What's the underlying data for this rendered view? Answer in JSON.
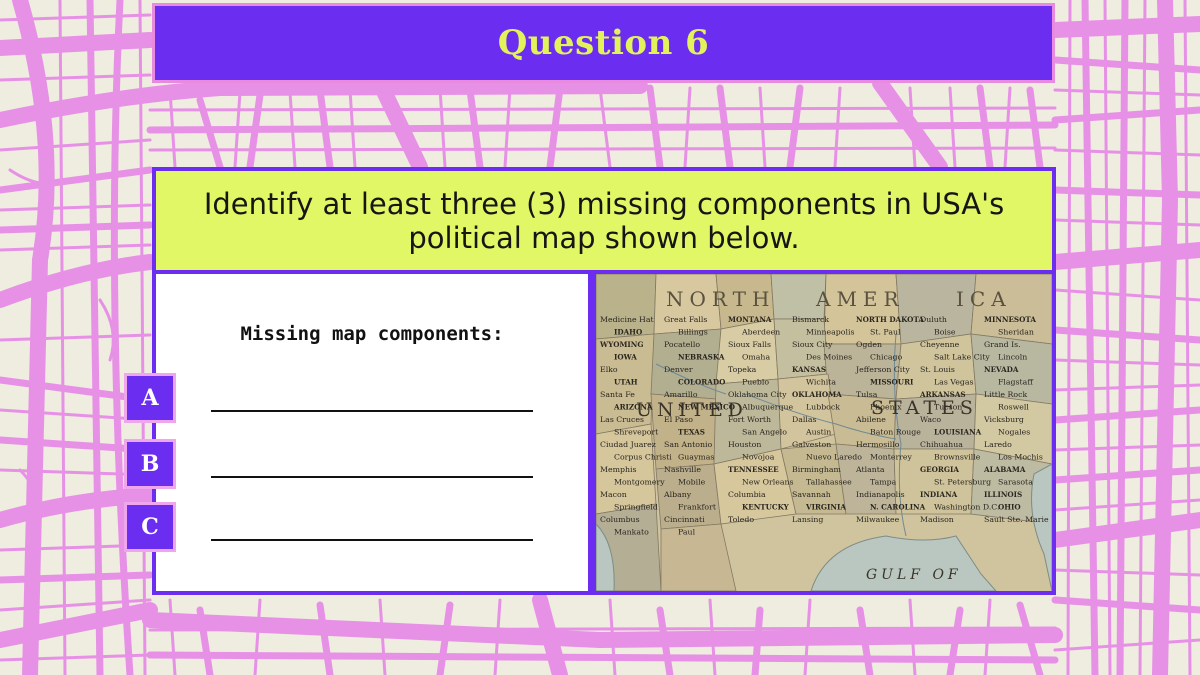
{
  "slide": {
    "title": "Question 6",
    "question": "Identify at least three (3) missing components in USA's political map shown below.",
    "answer_heading": "Missing map components:",
    "answer_letters": [
      "A",
      "B",
      "C"
    ]
  },
  "map_labels": {
    "top_row": [
      "NORTH",
      "AMER",
      "ICA"
    ],
    "states_word": [
      "UNITED",
      "STATES"
    ],
    "gulf": "GULF OF",
    "places": [
      "Medicine Hat",
      "Great Falls",
      "MONTANA",
      "Bismarck",
      "NORTH DAKOTA",
      "Duluth",
      "MINNESOTA",
      "IDAHO",
      "Billings",
      "Aberdeen",
      "Minneapolis",
      "St. Paul",
      "Boise",
      "Sheridan",
      "WYOMING",
      "Pocatello",
      "Sioux Falls",
      "Sioux City",
      "Ogden",
      "Cheyenne",
      "Grand Is.",
      "IOWA",
      "NEBRASKA",
      "Omaha",
      "Des Moines",
      "Chicago",
      "Salt Lake City",
      "Lincoln",
      "Elko",
      "Denver",
      "Topeka",
      "KANSAS",
      "Jefferson City",
      "St. Louis",
      "NEVADA",
      "UTAH",
      "COLORADO",
      "Pueblo",
      "Wichita",
      "MISSOURI",
      "Las Vegas",
      "Flagstaff",
      "Santa Fe",
      "Amarillo",
      "Oklahoma City",
      "OKLAHOMA",
      "Tulsa",
      "ARKANSAS",
      "Little Rock",
      "ARIZONA",
      "NEW MEXICO",
      "Albuquerque",
      "Lubbock",
      "Phoenix",
      "Tucson",
      "Roswell",
      "Las Cruces",
      "El Paso",
      "Fort Worth",
      "Dallas",
      "Abilene",
      "Waco",
      "Vicksburg",
      "Shreveport",
      "TEXAS",
      "San Angelo",
      "Austin",
      "Baton Rouge",
      "LOUISIANA",
      "Nogales",
      "Ciudad Juarez",
      "San Antonio",
      "Houston",
      "Galveston",
      "Hermosillo",
      "Chihuahua",
      "Laredo",
      "Corpus Christi",
      "Guaymas",
      "Novojoa",
      "Nuevo Laredo",
      "Monterrey",
      "Brownsville",
      "Los Mochis",
      "Memphis",
      "Nashville",
      "TENNESSEE",
      "Birmingham",
      "Atlanta",
      "GEORGIA",
      "ALABAMA",
      "Montgomery",
      "Mobile",
      "New Orleans",
      "Tallahassee",
      "Tampa",
      "St. Petersburg",
      "Sarasota",
      "Macon",
      "Albany",
      "Columbia",
      "Savannah",
      "Indianapolis",
      "INDIANA",
      "ILLINOIS",
      "Springfield",
      "Frankfort",
      "KENTUCKY",
      "VIRGINIA",
      "N. CAROLINA",
      "Washington D.C.",
      "OHIO",
      "Columbus",
      "Cincinnati",
      "Toledo",
      "Lansing",
      "Milwaukee",
      "Madison",
      "Sault Ste. Marie",
      "Mankato",
      "Paul"
    ]
  }
}
